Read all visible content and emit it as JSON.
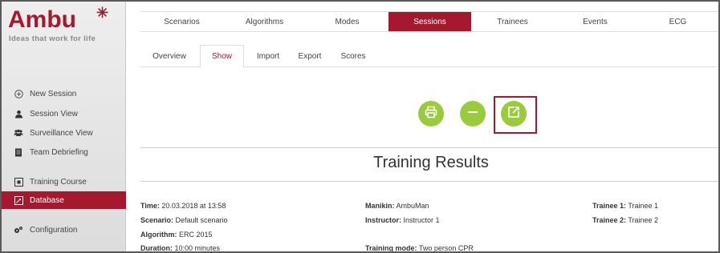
{
  "brand": {
    "name": "Ambu",
    "tagline": "Ideas that work for life",
    "accent": "#a5182e",
    "button_color": "#9acb3c"
  },
  "sidebar": {
    "items": [
      {
        "label": "New Session",
        "icon": "plus-circle-icon"
      },
      {
        "label": "Session View",
        "icon": "user-icon"
      },
      {
        "label": "Surveillance View",
        "icon": "group-icon"
      },
      {
        "label": "Team Debriefing",
        "icon": "document-icon"
      },
      {
        "label": "Training Course",
        "icon": "course-icon"
      },
      {
        "label": "Database",
        "icon": "database-icon",
        "active": true
      },
      {
        "label": "Configuration",
        "icon": "gears-icon"
      }
    ]
  },
  "topnav": {
    "tabs": [
      "Scenarios",
      "Algorithms",
      "Modes",
      "Sessions",
      "Trainees",
      "Events",
      "ECG"
    ],
    "active": "Sessions"
  },
  "subnav": {
    "tabs": [
      "Overview",
      "Show",
      "Import",
      "Export",
      "Scores"
    ],
    "active": "Show"
  },
  "actions": {
    "print": "print-icon",
    "collapse": "minus-icon",
    "open_external": "external-link-icon"
  },
  "results": {
    "title": "Training Results",
    "time_label": "Time:",
    "time_value": "20.03.2018 at 13:58",
    "scenario_label": "Scenario:",
    "scenario_value": "Default scenario",
    "algorithm_label": "Algorithm:",
    "algorithm_value": "ERC 2015",
    "duration_label": "Duration:",
    "duration_value": "10:00 minutes",
    "manikin_label": "Manikin:",
    "manikin_value": "AmbuMan",
    "instructor_label": "Instructor:",
    "instructor_value": "Instructor 1",
    "mode_label": "Training mode:",
    "mode_value": "Two person CPR",
    "trainee1_label": "Trainee 1:",
    "trainee1_value": "Trainee 1",
    "trainee2_label": "Trainee 2:",
    "trainee2_value": "Trainee 2"
  }
}
